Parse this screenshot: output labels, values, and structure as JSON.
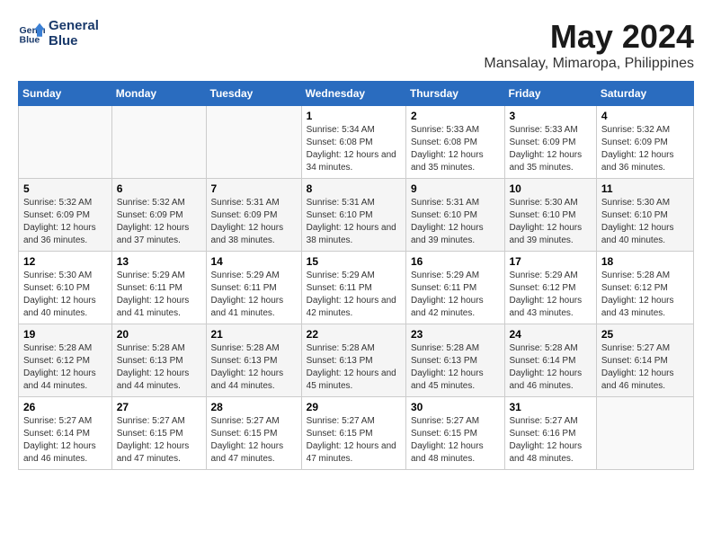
{
  "logo": {
    "line1": "General",
    "line2": "Blue"
  },
  "title": "May 2024",
  "subtitle": "Mansalay, Mimaropa, Philippines",
  "days_header": [
    "Sunday",
    "Monday",
    "Tuesday",
    "Wednesday",
    "Thursday",
    "Friday",
    "Saturday"
  ],
  "weeks": [
    [
      {
        "day": "",
        "sunrise": "",
        "sunset": "",
        "daylight": ""
      },
      {
        "day": "",
        "sunrise": "",
        "sunset": "",
        "daylight": ""
      },
      {
        "day": "",
        "sunrise": "",
        "sunset": "",
        "daylight": ""
      },
      {
        "day": "1",
        "sunrise": "Sunrise: 5:34 AM",
        "sunset": "Sunset: 6:08 PM",
        "daylight": "Daylight: 12 hours and 34 minutes."
      },
      {
        "day": "2",
        "sunrise": "Sunrise: 5:33 AM",
        "sunset": "Sunset: 6:08 PM",
        "daylight": "Daylight: 12 hours and 35 minutes."
      },
      {
        "day": "3",
        "sunrise": "Sunrise: 5:33 AM",
        "sunset": "Sunset: 6:09 PM",
        "daylight": "Daylight: 12 hours and 35 minutes."
      },
      {
        "day": "4",
        "sunrise": "Sunrise: 5:32 AM",
        "sunset": "Sunset: 6:09 PM",
        "daylight": "Daylight: 12 hours and 36 minutes."
      }
    ],
    [
      {
        "day": "5",
        "sunrise": "Sunrise: 5:32 AM",
        "sunset": "Sunset: 6:09 PM",
        "daylight": "Daylight: 12 hours and 36 minutes."
      },
      {
        "day": "6",
        "sunrise": "Sunrise: 5:32 AM",
        "sunset": "Sunset: 6:09 PM",
        "daylight": "Daylight: 12 hours and 37 minutes."
      },
      {
        "day": "7",
        "sunrise": "Sunrise: 5:31 AM",
        "sunset": "Sunset: 6:09 PM",
        "daylight": "Daylight: 12 hours and 38 minutes."
      },
      {
        "day": "8",
        "sunrise": "Sunrise: 5:31 AM",
        "sunset": "Sunset: 6:10 PM",
        "daylight": "Daylight: 12 hours and 38 minutes."
      },
      {
        "day": "9",
        "sunrise": "Sunrise: 5:31 AM",
        "sunset": "Sunset: 6:10 PM",
        "daylight": "Daylight: 12 hours and 39 minutes."
      },
      {
        "day": "10",
        "sunrise": "Sunrise: 5:30 AM",
        "sunset": "Sunset: 6:10 PM",
        "daylight": "Daylight: 12 hours and 39 minutes."
      },
      {
        "day": "11",
        "sunrise": "Sunrise: 5:30 AM",
        "sunset": "Sunset: 6:10 PM",
        "daylight": "Daylight: 12 hours and 40 minutes."
      }
    ],
    [
      {
        "day": "12",
        "sunrise": "Sunrise: 5:30 AM",
        "sunset": "Sunset: 6:10 PM",
        "daylight": "Daylight: 12 hours and 40 minutes."
      },
      {
        "day": "13",
        "sunrise": "Sunrise: 5:29 AM",
        "sunset": "Sunset: 6:11 PM",
        "daylight": "Daylight: 12 hours and 41 minutes."
      },
      {
        "day": "14",
        "sunrise": "Sunrise: 5:29 AM",
        "sunset": "Sunset: 6:11 PM",
        "daylight": "Daylight: 12 hours and 41 minutes."
      },
      {
        "day": "15",
        "sunrise": "Sunrise: 5:29 AM",
        "sunset": "Sunset: 6:11 PM",
        "daylight": "Daylight: 12 hours and 42 minutes."
      },
      {
        "day": "16",
        "sunrise": "Sunrise: 5:29 AM",
        "sunset": "Sunset: 6:11 PM",
        "daylight": "Daylight: 12 hours and 42 minutes."
      },
      {
        "day": "17",
        "sunrise": "Sunrise: 5:29 AM",
        "sunset": "Sunset: 6:12 PM",
        "daylight": "Daylight: 12 hours and 43 minutes."
      },
      {
        "day": "18",
        "sunrise": "Sunrise: 5:28 AM",
        "sunset": "Sunset: 6:12 PM",
        "daylight": "Daylight: 12 hours and 43 minutes."
      }
    ],
    [
      {
        "day": "19",
        "sunrise": "Sunrise: 5:28 AM",
        "sunset": "Sunset: 6:12 PM",
        "daylight": "Daylight: 12 hours and 44 minutes."
      },
      {
        "day": "20",
        "sunrise": "Sunrise: 5:28 AM",
        "sunset": "Sunset: 6:13 PM",
        "daylight": "Daylight: 12 hours and 44 minutes."
      },
      {
        "day": "21",
        "sunrise": "Sunrise: 5:28 AM",
        "sunset": "Sunset: 6:13 PM",
        "daylight": "Daylight: 12 hours and 44 minutes."
      },
      {
        "day": "22",
        "sunrise": "Sunrise: 5:28 AM",
        "sunset": "Sunset: 6:13 PM",
        "daylight": "Daylight: 12 hours and 45 minutes."
      },
      {
        "day": "23",
        "sunrise": "Sunrise: 5:28 AM",
        "sunset": "Sunset: 6:13 PM",
        "daylight": "Daylight: 12 hours and 45 minutes."
      },
      {
        "day": "24",
        "sunrise": "Sunrise: 5:28 AM",
        "sunset": "Sunset: 6:14 PM",
        "daylight": "Daylight: 12 hours and 46 minutes."
      },
      {
        "day": "25",
        "sunrise": "Sunrise: 5:27 AM",
        "sunset": "Sunset: 6:14 PM",
        "daylight": "Daylight: 12 hours and 46 minutes."
      }
    ],
    [
      {
        "day": "26",
        "sunrise": "Sunrise: 5:27 AM",
        "sunset": "Sunset: 6:14 PM",
        "daylight": "Daylight: 12 hours and 46 minutes."
      },
      {
        "day": "27",
        "sunrise": "Sunrise: 5:27 AM",
        "sunset": "Sunset: 6:15 PM",
        "daylight": "Daylight: 12 hours and 47 minutes."
      },
      {
        "day": "28",
        "sunrise": "Sunrise: 5:27 AM",
        "sunset": "Sunset: 6:15 PM",
        "daylight": "Daylight: 12 hours and 47 minutes."
      },
      {
        "day": "29",
        "sunrise": "Sunrise: 5:27 AM",
        "sunset": "Sunset: 6:15 PM",
        "daylight": "Daylight: 12 hours and 47 minutes."
      },
      {
        "day": "30",
        "sunrise": "Sunrise: 5:27 AM",
        "sunset": "Sunset: 6:15 PM",
        "daylight": "Daylight: 12 hours and 48 minutes."
      },
      {
        "day": "31",
        "sunrise": "Sunrise: 5:27 AM",
        "sunset": "Sunset: 6:16 PM",
        "daylight": "Daylight: 12 hours and 48 minutes."
      },
      {
        "day": "",
        "sunrise": "",
        "sunset": "",
        "daylight": ""
      }
    ]
  ]
}
